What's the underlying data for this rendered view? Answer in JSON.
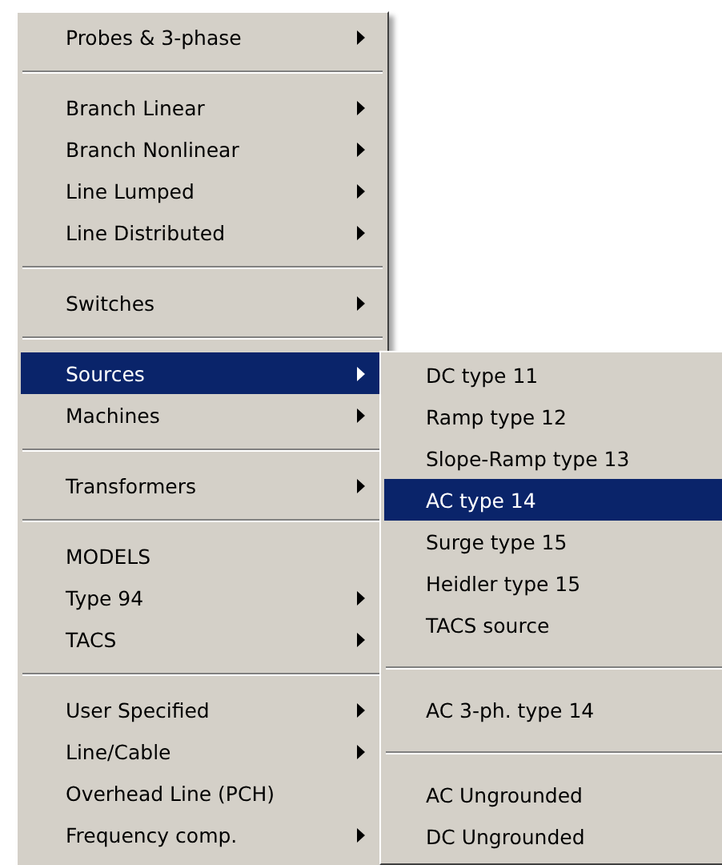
{
  "main_menu": {
    "items": [
      {
        "kind": "item",
        "label": "Probes & 3-phase",
        "has_submenu": true,
        "selected": false
      },
      {
        "kind": "separator"
      },
      {
        "kind": "item",
        "label": "Branch Linear",
        "has_submenu": true,
        "selected": false
      },
      {
        "kind": "item",
        "label": "Branch Nonlinear",
        "has_submenu": true,
        "selected": false
      },
      {
        "kind": "item",
        "label": "Line Lumped",
        "has_submenu": true,
        "selected": false
      },
      {
        "kind": "item",
        "label": "Line Distributed",
        "has_submenu": true,
        "selected": false
      },
      {
        "kind": "separator"
      },
      {
        "kind": "item",
        "label": "Switches",
        "has_submenu": true,
        "selected": false
      },
      {
        "kind": "separator"
      },
      {
        "kind": "item",
        "label": "Sources",
        "has_submenu": true,
        "selected": true
      },
      {
        "kind": "item",
        "label": "Machines",
        "has_submenu": true,
        "selected": false
      },
      {
        "kind": "separator"
      },
      {
        "kind": "item",
        "label": "Transformers",
        "has_submenu": true,
        "selected": false
      },
      {
        "kind": "separator"
      },
      {
        "kind": "item",
        "label": "MODELS",
        "has_submenu": false,
        "selected": false
      },
      {
        "kind": "item",
        "label": "Type 94",
        "has_submenu": true,
        "selected": false
      },
      {
        "kind": "item",
        "label": "TACS",
        "has_submenu": true,
        "selected": false
      },
      {
        "kind": "separator"
      },
      {
        "kind": "item",
        "label": "User Specified",
        "has_submenu": true,
        "selected": false
      },
      {
        "kind": "item",
        "label": "Line/Cable",
        "has_submenu": true,
        "selected": false
      },
      {
        "kind": "item",
        "label": "Overhead Line (PCH)",
        "has_submenu": false,
        "selected": false
      },
      {
        "kind": "item",
        "label": "Frequency comp.",
        "has_submenu": true,
        "selected": false
      }
    ]
  },
  "submenu": {
    "items": [
      {
        "kind": "item",
        "label": "DC type 11",
        "has_submenu": false,
        "selected": false
      },
      {
        "kind": "item",
        "label": "Ramp type 12",
        "has_submenu": false,
        "selected": false
      },
      {
        "kind": "item",
        "label": "Slope-Ramp type 13",
        "has_submenu": false,
        "selected": false
      },
      {
        "kind": "item",
        "label": "AC type 14",
        "has_submenu": false,
        "selected": true
      },
      {
        "kind": "item",
        "label": "Surge type 15",
        "has_submenu": false,
        "selected": false
      },
      {
        "kind": "item",
        "label": "Heidler type 15",
        "has_submenu": false,
        "selected": false
      },
      {
        "kind": "item",
        "label": "TACS source",
        "has_submenu": false,
        "selected": false
      },
      {
        "kind": "separator"
      },
      {
        "kind": "item",
        "label": "AC 3-ph. type 14",
        "has_submenu": false,
        "selected": false
      },
      {
        "kind": "separator"
      },
      {
        "kind": "item",
        "label": "AC Ungrounded",
        "has_submenu": false,
        "selected": false
      },
      {
        "kind": "item",
        "label": "DC Ungrounded",
        "has_submenu": false,
        "selected": false
      }
    ]
  }
}
